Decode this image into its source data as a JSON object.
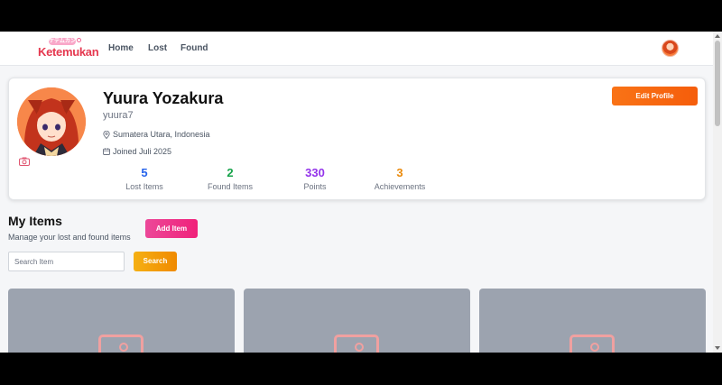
{
  "app": {
    "logo_sub": "ケテムカン",
    "logo_text": "Ketemukan"
  },
  "nav": {
    "links": [
      "Home",
      "Lost",
      "Found"
    ]
  },
  "profile": {
    "name": "Yuura Yozakura",
    "username": "yuura7",
    "location": "Sumatera Utara, Indonesia",
    "joined": "Joined Juli 2025",
    "edit_label": "Edit Profile",
    "stats": [
      {
        "value": "5",
        "label": "Lost Items",
        "color": "#2563eb"
      },
      {
        "value": "2",
        "label": "Found Items",
        "color": "#16a34a"
      },
      {
        "value": "330",
        "label": "Points",
        "color": "#9333ea"
      },
      {
        "value": "3",
        "label": "Achievements",
        "color": "#ea8a0c"
      }
    ]
  },
  "items_section": {
    "title": "My Items",
    "subtitle": "Manage your lost and found items",
    "add_label": "Add Item",
    "search_placeholder": "Search Item",
    "search_label": "Search"
  },
  "colors": {
    "accent_orange": "#f97316",
    "accent_pink": "#ec4899",
    "accent_amber": "#f5a30f",
    "placeholder_card": "#9ca3af"
  },
  "icons": {
    "location": "map-pin-icon",
    "joined": "calendar-icon",
    "camera": "camera-icon",
    "image": "image-placeholder-icon"
  }
}
